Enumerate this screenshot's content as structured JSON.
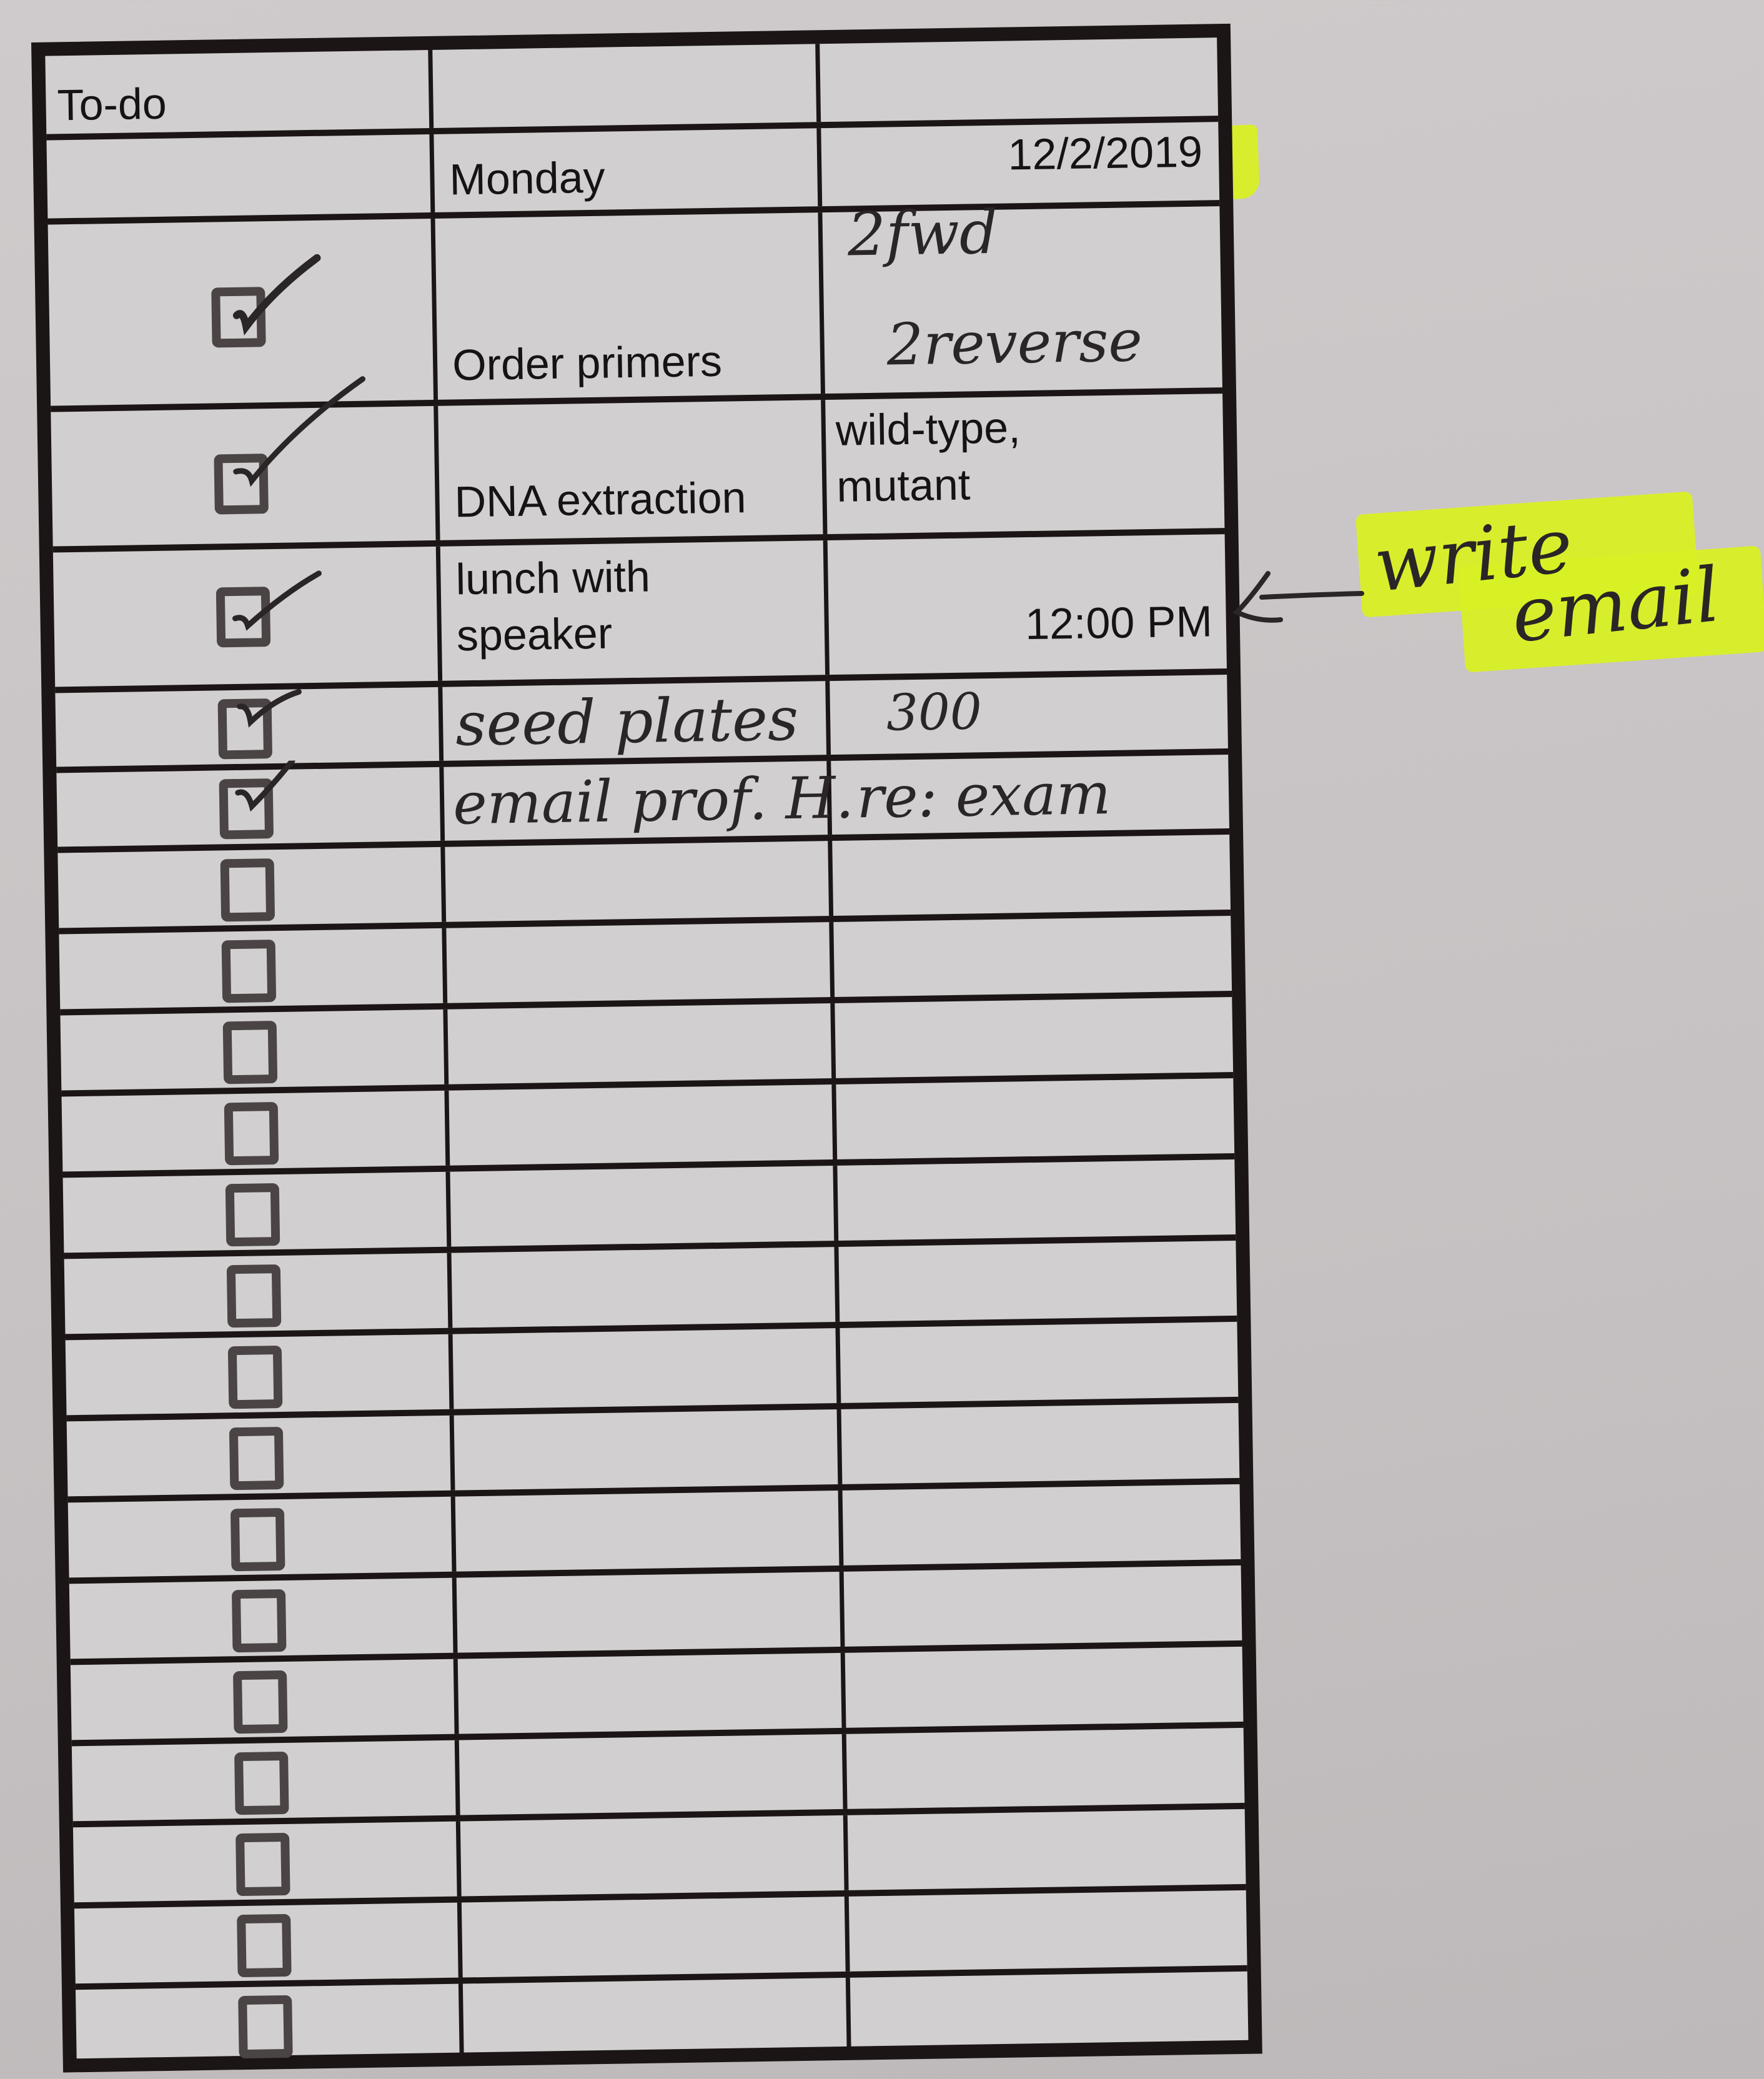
{
  "document": {
    "type": "printed to-do checklist with handwritten notes",
    "header": {
      "title": "To-do",
      "day": "Monday",
      "date": "12/2/2019",
      "date_highlight_color": "#d8f024"
    },
    "columns": [
      "checkbox",
      "task",
      "notes"
    ],
    "tasks": [
      {
        "checked": true,
        "task": "Order primers",
        "task_style": "printed",
        "notes": [
          "2fwd",
          "2reverse"
        ],
        "notes_style": "handwritten"
      },
      {
        "checked": true,
        "task": "DNA extraction",
        "task_style": "printed",
        "notes": [
          "wild-type,",
          "mutant"
        ],
        "notes_style": "printed"
      },
      {
        "checked": true,
        "task": "lunch with speaker",
        "task_lines": [
          "lunch with",
          "speaker"
        ],
        "task_style": "printed",
        "notes": [
          "12:00 PM"
        ],
        "notes_style": "printed"
      },
      {
        "checked": true,
        "task": "seed plates",
        "task_style": "handwritten",
        "notes": [
          "300"
        ],
        "notes_style": "handwritten"
      },
      {
        "checked": true,
        "task": "email prof. H.",
        "task_style": "handwritten",
        "notes": [
          "re: exam"
        ],
        "notes_style": "handwritten"
      }
    ],
    "empty_rows": 15,
    "margin_note": {
      "text_lines": [
        "write",
        "email"
      ],
      "arrow": "left-arrow",
      "points_to_task": "lunch with speaker",
      "highlight_color": "#d8f024"
    },
    "colors": {
      "paper": "#d2cfd0",
      "ink": "#1b1516",
      "pen": "#2a2526",
      "highlighter": "#d8f024"
    }
  }
}
